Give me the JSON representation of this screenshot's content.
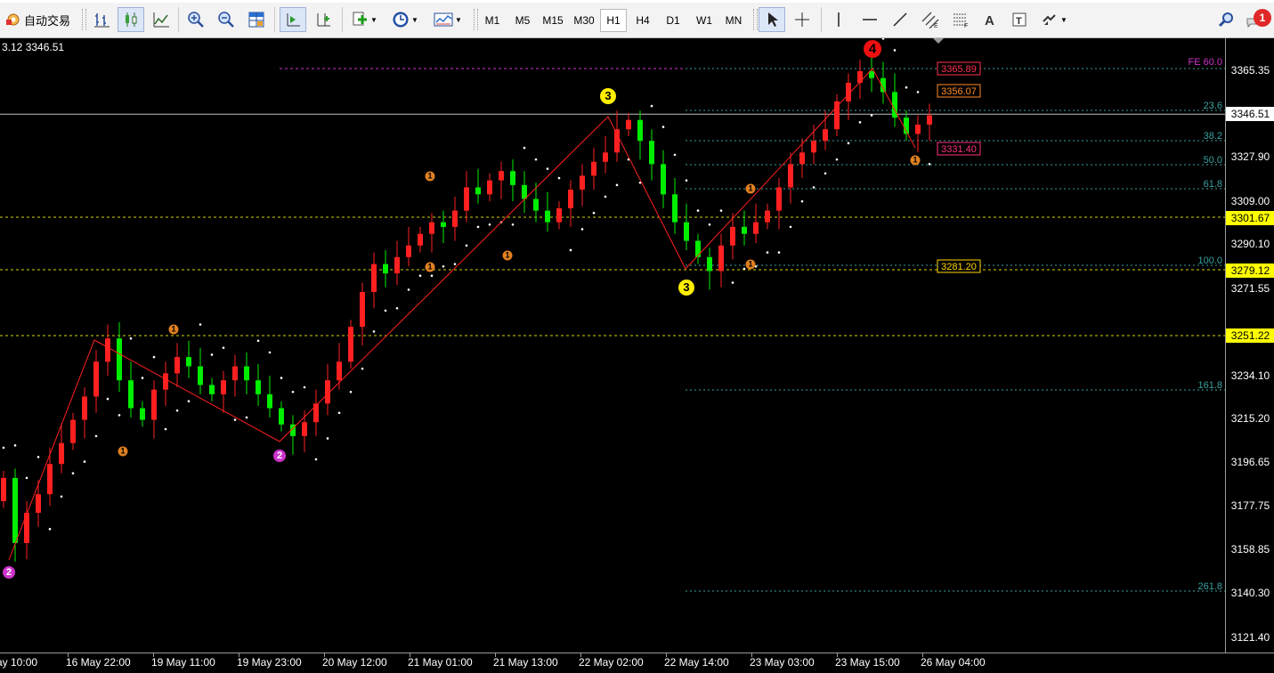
{
  "toolbar": {
    "auto_trade_label": "自动交易",
    "timeframes": [
      "M1",
      "M5",
      "M15",
      "M30",
      "H1",
      "H4",
      "D1",
      "W1",
      "MN"
    ],
    "active_timeframe": "H1",
    "notification_count": "1"
  },
  "chart": {
    "ohlc_header": "3.12 3346.51",
    "current_price": "3346.51",
    "price_ticks": [
      "3365.35",
      "3327.90",
      "3309.00",
      "3290.10",
      "3271.55",
      "3234.10",
      "3215.20",
      "3196.65",
      "3177.75",
      "3158.85",
      "3140.30",
      "3121.40"
    ],
    "time_labels": [
      "ay 10:00",
      "16 May 22:00",
      "19 May 11:00",
      "19 May 23:00",
      "20 May 12:00",
      "21 May 01:00",
      "21 May 13:00",
      "22 May 02:00",
      "22 May 14:00",
      "23 May 03:00",
      "23 May 15:00",
      "26 May 04:00"
    ],
    "level_tags": [
      {
        "text": "3301.67",
        "bg": "#ffff00",
        "fg": "#000000"
      },
      {
        "text": "3279.12",
        "bg": "#ffff00",
        "fg": "#000000"
      },
      {
        "text": "3251.22",
        "bg": "#ffff00",
        "fg": "#000000"
      }
    ],
    "inline_tags": [
      {
        "text": "3365.89",
        "color": "#ff3050"
      },
      {
        "text": "3356.07",
        "color": "#ff8c28"
      },
      {
        "text": "3331.40",
        "color": "#ff3080"
      },
      {
        "text": "3281.20",
        "color": "#ffd700"
      }
    ],
    "fib_labels": [
      "23.6",
      "38.2",
      "50.0",
      "61.8",
      "100.0",
      "161.8",
      "261.8"
    ],
    "fe_label": "FE 60.0",
    "wave_labels": [
      "2",
      "1",
      "1",
      "2",
      "1",
      "1",
      "1",
      "3",
      "1",
      "3",
      "1",
      "4",
      "1"
    ],
    "colors": {
      "bull": "#ff2020",
      "bear": "#00ee00",
      "zigzag": "#ff2020",
      "fib": "#3aa0a0",
      "level": "#d4d400",
      "magenta": "#cc33cc",
      "orange": "#e08020",
      "yellow": "#ffee00",
      "red_circle": "#ee1010"
    }
  },
  "chart_data": {
    "type": "candlestick",
    "symbol_timeframe": "H1",
    "ylim": [
      3121.4,
      3365.35
    ],
    "closes": [
      3190,
      3162,
      3175,
      3183,
      3196,
      3205,
      3215,
      3225,
      3240,
      3250,
      3232,
      3220,
      3215,
      3228,
      3235,
      3242,
      3238,
      3230,
      3226,
      3232,
      3238,
      3232,
      3226,
      3220,
      3213,
      3208,
      3214,
      3222,
      3232,
      3240,
      3255,
      3270,
      3282,
      3278,
      3285,
      3290,
      3295,
      3300,
      3298,
      3305,
      3315,
      3312,
      3318,
      3322,
      3316,
      3310,
      3305,
      3300,
      3306,
      3314,
      3320,
      3326,
      3330,
      3340,
      3344,
      3335,
      3325,
      3312,
      3300,
      3292,
      3285,
      3279,
      3290,
      3298,
      3295,
      3300,
      3305,
      3315,
      3325,
      3330,
      3335,
      3340,
      3352,
      3360,
      3365,
      3362,
      3356,
      3345,
      3338,
      3342,
      3346
    ]
  }
}
